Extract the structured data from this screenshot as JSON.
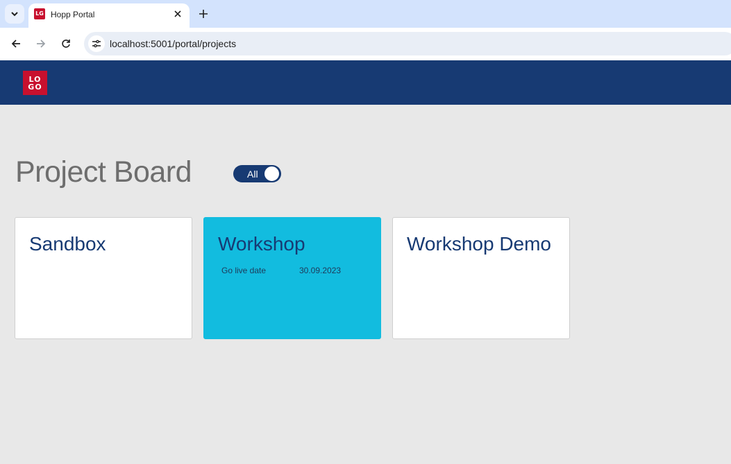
{
  "browser": {
    "tab_title": "Hopp Portal",
    "favicon_text": "LG",
    "url": "localhost:5001/portal/projects",
    "icons": {
      "tab_search": "chevron-down-icon",
      "tab_close": "close-icon",
      "new_tab": "plus-icon",
      "back": "arrow-left-icon",
      "forward": "arrow-right-icon",
      "reload": "reload-icon",
      "site_info": "tune-icon"
    }
  },
  "header": {
    "logo_line1": "LO",
    "logo_line2": "GO",
    "background": "#173a73",
    "logo_color": "#c8102e"
  },
  "page": {
    "title": "Project Board",
    "filter_toggle_label": "All"
  },
  "projects": [
    {
      "name": "Sandbox",
      "highlighted": false
    },
    {
      "name": "Workshop",
      "highlighted": true,
      "meta_label": "Go live date",
      "meta_value": "30.09.2023",
      "color": "#12bcdf"
    },
    {
      "name": "Workshop Demo",
      "highlighted": false
    }
  ]
}
